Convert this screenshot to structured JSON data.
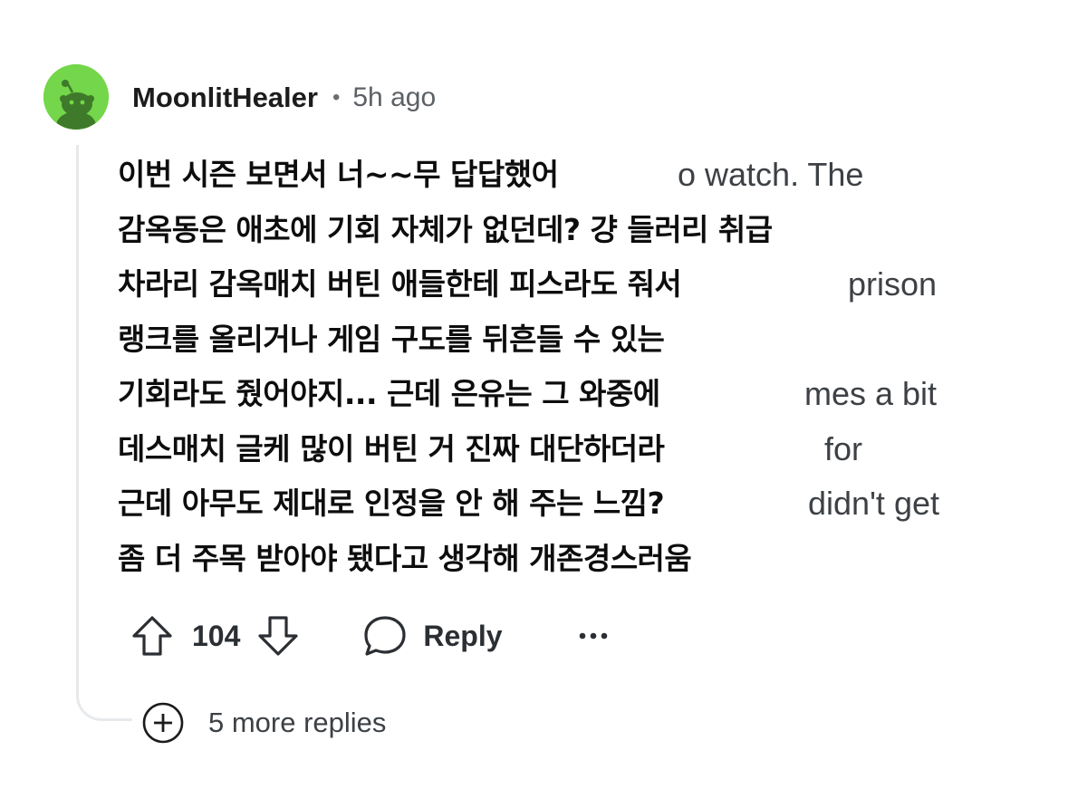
{
  "comment": {
    "username": "MoonlitHealer",
    "separator": "•",
    "timestamp": "5h ago",
    "avatar_color": "#74d64a",
    "lines": [
      {
        "korean": "이번 시즌 보면서 너~~무 답답했어",
        "english": "o watch. The",
        "english_indent": 618
      },
      {
        "korean": "감옥동은 애초에 기회 자체가 없던데? 걍 들러리 취급",
        "english": "",
        "english_indent": 0
      },
      {
        "korean": "차라리 감옥매치 버틴 애들한테 피스라도 줘서",
        "english": "prison",
        "english_indent": 806
      },
      {
        "korean": "랭크를 올리거나 게임 구도를 뒤흔들 수 있는",
        "english": "",
        "english_indent": 0
      },
      {
        "korean": "기회라도 줬어야지... 근데 은유는 그 와중에",
        "english": "mes a bit",
        "english_indent": 758
      },
      {
        "korean": "데스매치 글케 많이 버틴 거 진짜 대단하더라",
        "english": "for",
        "english_indent": 780
      },
      {
        "korean": "근데 아무도 제대로 인정을 안 해 주는 느낌?",
        "english": "didn't get",
        "english_indent": 762
      },
      {
        "korean": "좀 더 주목 받아야 됐다고 생각해 개존경스러움",
        "english": "",
        "english_indent": 0
      }
    ]
  },
  "actions": {
    "upvote_icon": "arrow-up-outline",
    "vote_count": "104",
    "downvote_icon": "arrow-down-outline",
    "reply_icon": "speech-bubble",
    "reply_label": "Reply",
    "more_icon": "ellipsis"
  },
  "more_replies": {
    "icon": "plus-circle",
    "label": "5 more replies"
  }
}
